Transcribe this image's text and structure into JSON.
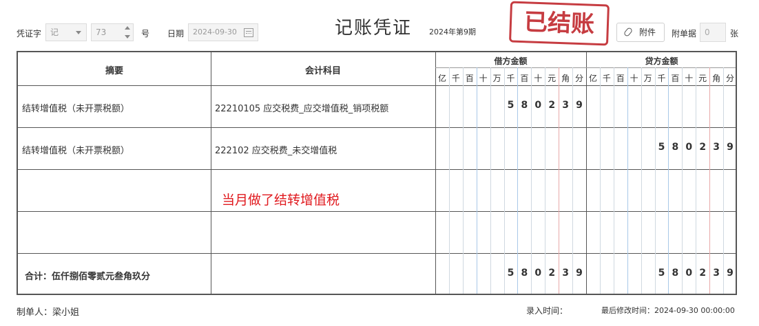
{
  "header": {
    "voucher_type_label": "凭证字",
    "voucher_type_value": "记",
    "voucher_no_value": "73",
    "voucher_no_suffix": "号",
    "date_label": "日期",
    "date_value": "2024-09-30",
    "title": "记账凭证",
    "period": "2024年第9期",
    "stamp": "已结账",
    "attachment_button": "附件",
    "attach_count_label": "附单据",
    "attach_count_value": "0",
    "attach_count_unit": "张"
  },
  "table": {
    "col_summary": "摘要",
    "col_account": "会计科目",
    "col_debit": "借方金额",
    "col_credit": "贷方金额",
    "digit_units": [
      "亿",
      "千",
      "百",
      "十",
      "万",
      "千",
      "百",
      "十",
      "元",
      "角",
      "分"
    ],
    "rows": [
      {
        "summary": "结转增值税（未开票税额）",
        "account": "22210105 应交税费_应交增值税_销项税额",
        "debit": "580239",
        "credit": ""
      },
      {
        "summary": "结转增值税（未开票税额）",
        "account": "222102 应交税费_未交增值税",
        "debit": "",
        "credit": "580239"
      },
      {
        "summary": "",
        "account": "",
        "debit": "",
        "credit": ""
      },
      {
        "summary": "",
        "account": "",
        "debit": "",
        "credit": ""
      }
    ],
    "total_label": "合计：伍仟捌佰零贰元叁角玖分",
    "total_debit": "580239",
    "total_credit": "580239"
  },
  "annotation": "当月做了结转增值税",
  "footer": {
    "maker_label": "制单人：梁小姐",
    "entry_time_label": "录入时间：",
    "modified_time_label": "最后修改时间：2024-09-30 00:00:00"
  },
  "colors": {
    "stamp": "#c0272d",
    "annotation": "#e0191e",
    "border": "#555555"
  }
}
